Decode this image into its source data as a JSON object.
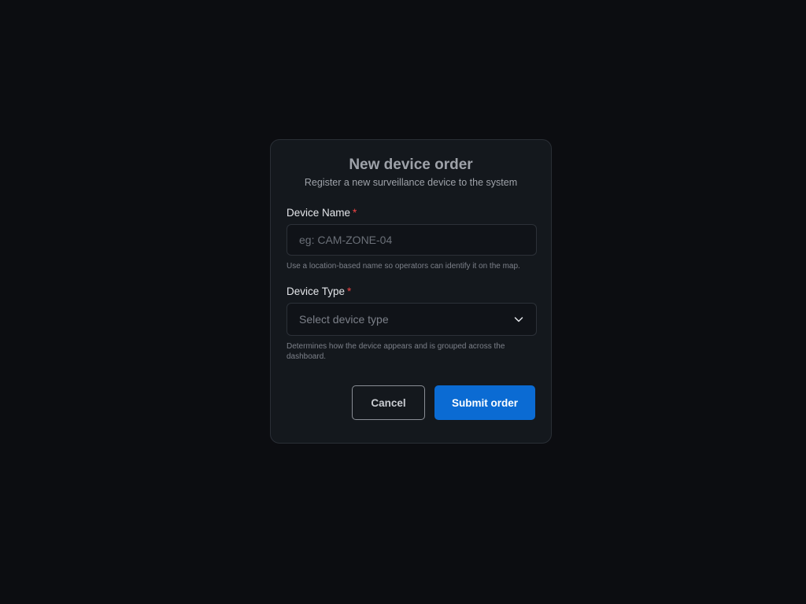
{
  "modal": {
    "title": "New device order",
    "subtitle": "Register a new surveillance device to the system"
  },
  "device_name": {
    "label": "Device Name",
    "required_marker": "*",
    "value": "",
    "placeholder": "eg: CAM-ZONE-04",
    "helper": "Use a location-based name so operators can identify it on the map."
  },
  "device_type": {
    "label": "Device Type",
    "required_marker": "*",
    "selected": "Select device type",
    "icon": "chevron-down-icon",
    "helper": "Determines how the device appears and is grouped across the dashboard."
  },
  "actions": {
    "cancel_label": "Cancel",
    "submit_label": "Submit order"
  },
  "colors": {
    "background": "#0c0d11",
    "panel": "#14181d",
    "accent": "#0b6bd3",
    "required": "#ef4444"
  }
}
